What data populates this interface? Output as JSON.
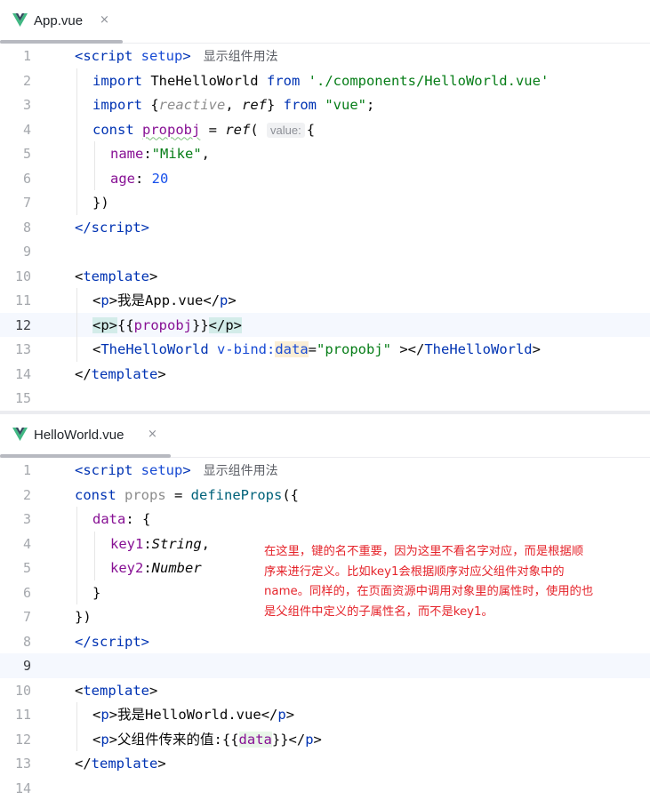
{
  "app_pane": {
    "tab": {
      "label": "App.vue",
      "close": "×"
    },
    "lines": [
      {
        "n": "1",
        "tokens": [
          [
            "tag",
            "<script "
          ],
          [
            "attr",
            "setup"
          ],
          [
            "tag",
            ">"
          ]
        ],
        "inlay": "显示组件用法"
      },
      {
        "n": "2",
        "tokens": [
          [
            "kw",
            "import "
          ],
          [
            "ident",
            "TheHelloWorld "
          ],
          [
            "kw",
            "from "
          ],
          [
            "str",
            "'./components/HelloWorld.vue'"
          ]
        ]
      },
      {
        "n": "3",
        "tokens": [
          [
            "kw",
            "import "
          ],
          [
            "ident",
            "{"
          ],
          [
            "grey ital",
            "reactive"
          ],
          [
            "ident",
            ", "
          ],
          [
            "ital ident",
            "ref"
          ],
          [
            "ident",
            "} "
          ],
          [
            "kw",
            "from "
          ],
          [
            "str",
            "\"vue\""
          ],
          [
            "ident",
            ";"
          ]
        ]
      },
      {
        "n": "4",
        "tokens": [
          [
            "kw",
            "const "
          ],
          [
            "var squiggle",
            "propobj"
          ],
          [
            "ident",
            " = "
          ],
          [
            "ital ident",
            "ref"
          ],
          [
            "ident",
            "( "
          ],
          [
            "hint",
            "value:"
          ],
          [
            "ident",
            "{"
          ]
        ]
      },
      {
        "n": "5",
        "tokens": [
          [
            "prop",
            "name"
          ],
          [
            "ident",
            ":"
          ],
          [
            "str",
            "\"Mike\""
          ],
          [
            "ident",
            ","
          ]
        ]
      },
      {
        "n": "6",
        "tokens": [
          [
            "prop",
            "age"
          ],
          [
            "ident",
            ": "
          ],
          [
            "num",
            "20"
          ]
        ]
      },
      {
        "n": "7",
        "tokens": [
          [
            "ident",
            "})"
          ]
        ]
      },
      {
        "n": "8",
        "tokens": [
          [
            "tag",
            "</script"
          ],
          [
            "tag",
            ">"
          ]
        ]
      },
      {
        "n": "9",
        "tokens": []
      },
      {
        "n": "10",
        "tokens": [
          [
            "ident",
            "<"
          ],
          [
            "tag",
            "template"
          ],
          [
            "ident",
            ">"
          ]
        ]
      },
      {
        "n": "11",
        "tokens": [
          [
            "ident",
            "<"
          ],
          [
            "tag",
            "p"
          ],
          [
            "ident",
            ">"
          ],
          [
            "ident",
            "我是App.vue"
          ],
          [
            "ident",
            "</"
          ],
          [
            "tag",
            "p"
          ],
          [
            "ident",
            ">"
          ]
        ]
      },
      {
        "n": "12",
        "tokens": [
          [
            "tag-hl",
            "<p>"
          ],
          [
            "ident",
            "{{"
          ],
          [
            "var",
            "propobj"
          ],
          [
            "ident",
            "}}"
          ],
          [
            "tag-hl",
            "</p>"
          ]
        ]
      },
      {
        "n": "13",
        "tokens": [
          [
            "ident",
            "<"
          ],
          [
            "tag",
            "TheHelloWorld "
          ],
          [
            "attr",
            "v-bind:"
          ],
          [
            "attr attr-hl",
            "data"
          ],
          [
            "ident",
            "="
          ],
          [
            "str",
            "\"propobj\""
          ],
          [
            "ident",
            " ></"
          ],
          [
            "tag",
            "TheHelloWorld"
          ],
          [
            "ident",
            ">"
          ]
        ]
      },
      {
        "n": "14",
        "tokens": [
          [
            "ident",
            "</"
          ],
          [
            "tag",
            "template"
          ],
          [
            "ident",
            ">"
          ]
        ]
      },
      {
        "n": "15",
        "tokens": []
      }
    ]
  },
  "hello_pane": {
    "tab": {
      "label": "HelloWorld.vue",
      "close": "×"
    },
    "lines": [
      {
        "n": "1",
        "tokens": [
          [
            "tag",
            "<script "
          ],
          [
            "attr",
            "setup"
          ],
          [
            "tag",
            ">"
          ]
        ],
        "inlay": "显示组件用法"
      },
      {
        "n": "2",
        "tokens": [
          [
            "kw",
            "const "
          ],
          [
            "grey",
            "props"
          ],
          [
            "ident",
            " = "
          ],
          [
            "fn",
            "defineProps"
          ],
          [
            "ident",
            "({"
          ]
        ]
      },
      {
        "n": "3",
        "tokens": [
          [
            "prop",
            "data"
          ],
          [
            "ident",
            ": {"
          ]
        ]
      },
      {
        "n": "4",
        "tokens": [
          [
            "prop",
            "key1"
          ],
          [
            "ident",
            ":"
          ],
          [
            "ital ident",
            "String"
          ],
          [
            "ident",
            ","
          ]
        ]
      },
      {
        "n": "5",
        "tokens": [
          [
            "prop",
            "key2"
          ],
          [
            "ident",
            ":"
          ],
          [
            "ital ident",
            "Number"
          ]
        ]
      },
      {
        "n": "6",
        "tokens": [
          [
            "ident",
            "}"
          ]
        ]
      },
      {
        "n": "7",
        "tokens": [
          [
            "ident",
            "})"
          ]
        ]
      },
      {
        "n": "8",
        "tokens": [
          [
            "tag",
            "</script"
          ],
          [
            "tag",
            ">"
          ]
        ]
      },
      {
        "n": "9",
        "tokens": []
      },
      {
        "n": "10",
        "tokens": [
          [
            "ident",
            "<"
          ],
          [
            "tag",
            "template"
          ],
          [
            "ident",
            ">"
          ]
        ]
      },
      {
        "n": "11",
        "tokens": [
          [
            "ident",
            "<"
          ],
          [
            "tag",
            "p"
          ],
          [
            "ident",
            ">"
          ],
          [
            "ident",
            "我是HelloWorld.vue"
          ],
          [
            "ident",
            "</"
          ],
          [
            "tag",
            "p"
          ],
          [
            "ident",
            ">"
          ]
        ]
      },
      {
        "n": "12",
        "tokens": [
          [
            "ident",
            "<"
          ],
          [
            "tag",
            "p"
          ],
          [
            "ident",
            ">"
          ],
          [
            "ident",
            "父组件传来的值:{{"
          ],
          [
            "var data-hl",
            "data"
          ],
          [
            "ident",
            "}}</"
          ],
          [
            "tag",
            "p"
          ],
          [
            "ident",
            ">"
          ]
        ]
      },
      {
        "n": "13",
        "tokens": [
          [
            "ident",
            "</"
          ],
          [
            "tag",
            "template"
          ],
          [
            "ident",
            ">"
          ]
        ]
      },
      {
        "n": "14",
        "tokens": []
      }
    ]
  },
  "annotation": {
    "lines": [
      "在这里，键的名不重要，因为这里不看名字对应，而是根据顺",
      "序来进行定义。比如key1会根据顺序对应父组件对象中的",
      "name。同样的，在页面资源中调用对象里的属性时，使用的也",
      "是父组件中定义的子属性名，而不是key1。"
    ]
  },
  "colors": {
    "tag": "#0033b3",
    "string": "#067d17",
    "number": "#1750eb",
    "property": "#871094",
    "annotation_text": "#e5242b",
    "vue_green": "#41b883",
    "vue_dark": "#35495e"
  }
}
